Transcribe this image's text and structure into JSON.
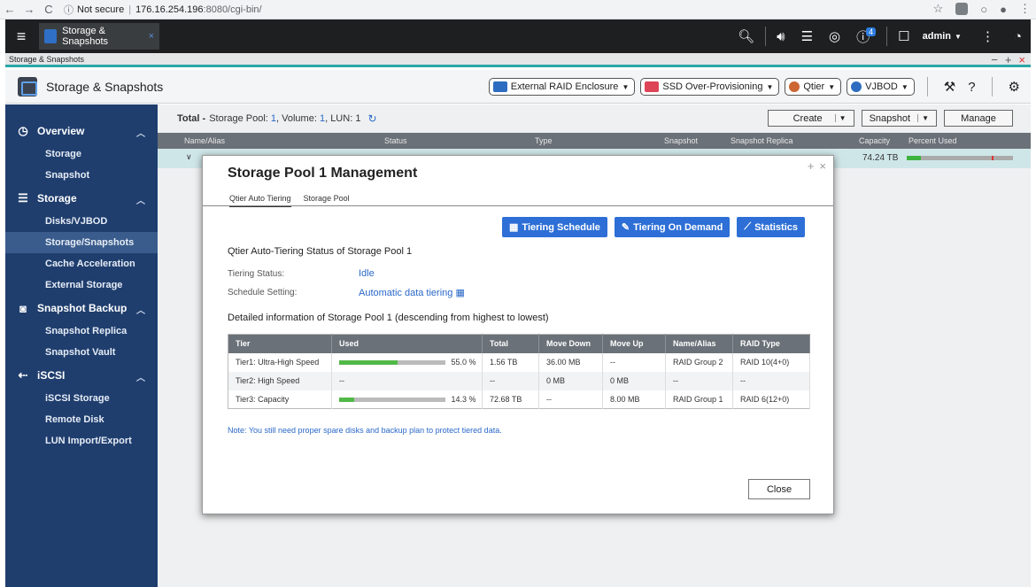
{
  "browser": {
    "security": "Not secure",
    "host": "176.16.254.196",
    "port_path": ":8080/cgi-bin/"
  },
  "topbar": {
    "app_tab_label": "Storage & Snapshots",
    "notification_count": "4",
    "user": "admin"
  },
  "window": {
    "strip_title": "Storage & Snapshots",
    "header_title": "Storage & Snapshots"
  },
  "header_tools": {
    "external_raid": "External RAID Enclosure",
    "ssd_overprov": "SSD Over-Provisioning",
    "qtier": "Qtier",
    "vjbod": "VJBOD"
  },
  "sidebar": {
    "overview": "Overview",
    "overview_items": [
      "Storage",
      "Snapshot"
    ],
    "storage": "Storage",
    "storage_items": [
      "Disks/VJBOD",
      "Storage/Snapshots",
      "Cache Acceleration",
      "External Storage"
    ],
    "snapshot_backup": "Snapshot Backup",
    "snapshot_backup_items": [
      "Snapshot Replica",
      "Snapshot Vault"
    ],
    "iscsi": "iSCSI",
    "iscsi_items": [
      "iSCSI Storage",
      "Remote Disk",
      "LUN Import/Export"
    ]
  },
  "main": {
    "total_label": "Total -",
    "total_pool_text": "Storage Pool:",
    "total_pool_count": "1",
    "total_volume_text": ", Volume:",
    "total_volume_count": "1",
    "total_lun_text": ", LUN:",
    "total_lun_count": "1",
    "create": "Create",
    "snapshot": "Snapshot",
    "manage": "Manage",
    "columns": {
      "name": "Name/Alias",
      "status": "Status",
      "type": "Type",
      "snapshot": "Snapshot",
      "replica": "Snapshot Replica",
      "capacity": "Capacity",
      "percent": "Percent Used"
    },
    "row_capacity": "74.24 TB",
    "row_percent_used": 0.13
  },
  "modal": {
    "title": "Storage Pool 1 Management",
    "tabs": [
      "Qtier Auto Tiering",
      "Storage Pool"
    ],
    "btn_schedule": "Tiering Schedule",
    "btn_on_demand": "Tiering On Demand",
    "btn_statistics": "Statistics",
    "status_heading": "Qtier Auto-Tiering Status of Storage Pool 1",
    "tiering_status_label": "Tiering Status:",
    "tiering_status_value": "Idle",
    "schedule_label": "Schedule Setting:",
    "schedule_value": "Automatic data tiering",
    "detail_heading": "Detailed information of Storage Pool 1 (descending from highest to lowest)",
    "table_headers": [
      "Tier",
      "Used",
      "Total",
      "Move Down",
      "Move Up",
      "Name/Alias",
      "RAID Type"
    ],
    "rows": [
      {
        "tier": "Tier1: Ultra-High Speed",
        "used_fraction": 0.55,
        "used_text": "55.0 %",
        "total": "1.56 TB",
        "move_down": "36.00 MB",
        "move_up": "--",
        "name": "RAID Group 2",
        "raid": "RAID 10(4+0)"
      },
      {
        "tier": "Tier2: High Speed",
        "used_fraction": null,
        "used_text": "--",
        "total": "--",
        "move_down": "0 MB",
        "move_up": "0 MB",
        "name": "--",
        "raid": "--"
      },
      {
        "tier": "Tier3: Capacity",
        "used_fraction": 0.143,
        "used_text": "14.3 %",
        "total": "72.68 TB",
        "move_down": "--",
        "move_up": "8.00 MB",
        "name": "RAID Group 1",
        "raid": "RAID 6(12+0)"
      }
    ],
    "note": "Note: You still need proper spare disks and backup plan to protect tiered data.",
    "close": "Close"
  }
}
